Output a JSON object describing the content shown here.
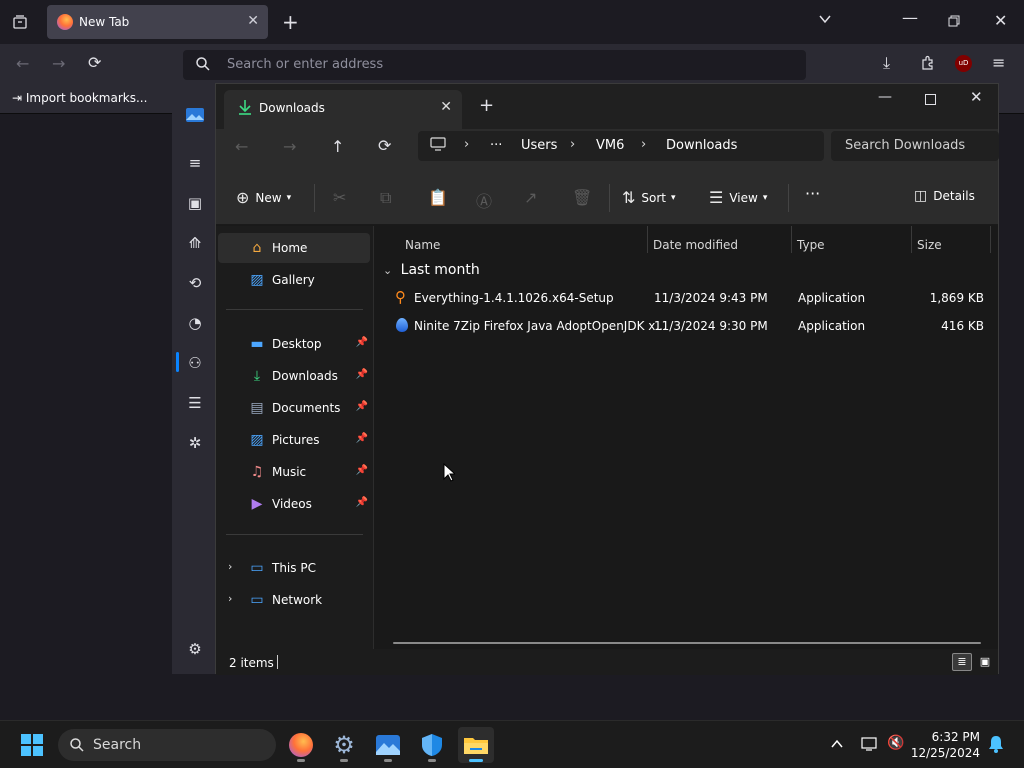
{
  "browser": {
    "tab_title": "New Tab",
    "address_placeholder": "Search or enter address",
    "bookmarks_import_label": "Import bookmarks..."
  },
  "explorer": {
    "tab_title": "Downloads",
    "breadcrumbs": [
      "Users",
      "VM6",
      "Downloads"
    ],
    "search_placeholder": "Search Downloads",
    "toolbar": {
      "new_label": "New",
      "sort_label": "Sort",
      "view_label": "View",
      "details_label": "Details"
    },
    "nav": {
      "home": "Home",
      "gallery": "Gallery",
      "desktop": "Desktop",
      "downloads": "Downloads",
      "documents": "Documents",
      "pictures": "Pictures",
      "music": "Music",
      "videos": "Videos",
      "this_pc": "This PC",
      "network": "Network"
    },
    "columns": [
      "Name",
      "Date modified",
      "Type",
      "Size"
    ],
    "group_label": "Last month",
    "files": [
      {
        "name": "Everything-1.4.1.1026.x64-Setup",
        "date": "11/3/2024 9:43 PM",
        "type": "Application",
        "size": "1,869 KB"
      },
      {
        "name": "Ninite 7Zip Firefox Java AdoptOpenJDK x...",
        "date": "11/3/2024 9:30 PM",
        "type": "Application",
        "size": "416 KB"
      }
    ],
    "status_text": "2 items"
  },
  "taskbar": {
    "search_placeholder": "Search",
    "time": "6:32 PM",
    "date": "12/25/2024"
  },
  "colors": {
    "accent": "#4cc2ff",
    "download_green": "#3ddc84",
    "folder_yellow": "#ffc83d"
  }
}
